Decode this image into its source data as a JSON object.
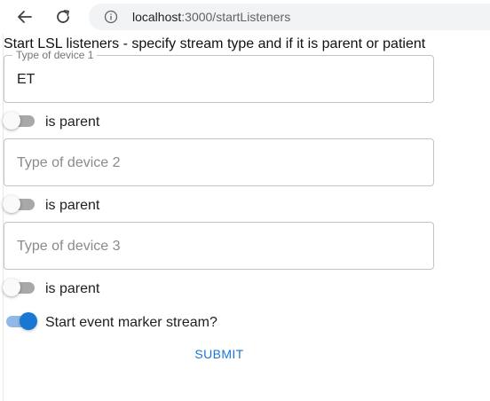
{
  "browser": {
    "url_host": "localhost",
    "url_path": ":3000/startListeners",
    "icons": {
      "back": "arrow-left-icon",
      "reload": "reload-icon",
      "info": "info-icon"
    }
  },
  "form": {
    "heading": "Start LSL listeners - specify stream type and if it is parent or patient",
    "devices": [
      {
        "floating_label": "Type of device 1",
        "value": "ET",
        "placeholder": "",
        "is_parent_label": "is parent",
        "is_parent": false
      },
      {
        "floating_label": "",
        "value": "",
        "placeholder": "Type of device 2",
        "is_parent_label": "is parent",
        "is_parent": false
      },
      {
        "floating_label": "",
        "value": "",
        "placeholder": "Type of device 3",
        "is_parent_label": "is parent",
        "is_parent": false
      }
    ],
    "event_marker": {
      "label": "Start event marker stream?",
      "enabled": true
    },
    "submit_label": "SUBMIT"
  },
  "colors": {
    "primary": "#1976d2",
    "switch_on_track": "#90b9e8",
    "switch_off_track": "#a8a8a8",
    "field_border": "#c4c4c4",
    "omnibox_bg": "#f1f3f4"
  }
}
